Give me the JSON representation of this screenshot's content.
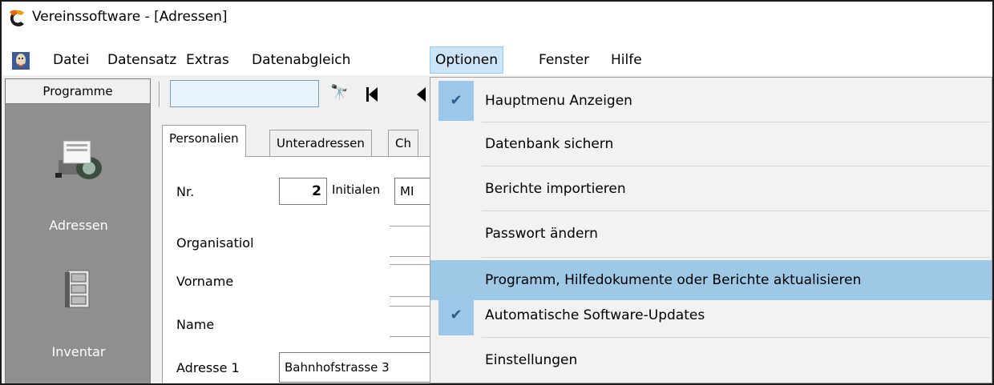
{
  "window": {
    "title": "Vereinssoftware - [Adressen]"
  },
  "menubar": {
    "items": [
      {
        "label": "Datei"
      },
      {
        "label": "Datensatz"
      },
      {
        "label": "Extras"
      },
      {
        "label": "Datenabgleich"
      },
      {
        "label": "Optionen"
      },
      {
        "label": "Fenster"
      },
      {
        "label": "Hilfe"
      }
    ]
  },
  "sidebar": {
    "header": "Programme",
    "items": [
      {
        "label": "Adressen",
        "icon": "rolodex-icon"
      },
      {
        "label": "Inventar",
        "icon": "cabinet-icon"
      }
    ]
  },
  "toolbar": {
    "search_value": "",
    "icons": [
      "binoculars-icon",
      "first-record-icon",
      "previous-record-icon"
    ]
  },
  "tabs": [
    {
      "label": "Personalien"
    },
    {
      "label": "Unteradressen"
    },
    {
      "label": "Ch"
    }
  ],
  "form": {
    "nr_label": "Nr.",
    "nr_value": "2",
    "initialen_label": "Initialen",
    "initialen_value": "MI",
    "organisation_label": "Organisatiol",
    "vorname_label": "Vorname",
    "name_label": "Name",
    "adresse1_label": "Adresse 1",
    "adresse1_value": "Bahnhofstrasse 3"
  },
  "dropdown": {
    "items": [
      {
        "label": "Hauptmenu Anzeigen",
        "checked": true
      },
      {
        "label": "Datenbank sichern",
        "checked": false
      },
      {
        "label": "Berichte importieren",
        "checked": false
      },
      {
        "label": "Passwort ändern",
        "checked": false
      },
      {
        "label": "Programm, Hilfedokumente oder Berichte aktualisieren",
        "checked": false
      },
      {
        "label": "Automatische Software-Updates",
        "checked": true
      },
      {
        "label": "Einstellungen",
        "checked": false
      }
    ]
  },
  "colors": {
    "highlight": "#9ec9e6",
    "menu_open": "#cce4f7",
    "sidebar_bg": "#8f8f8f"
  }
}
